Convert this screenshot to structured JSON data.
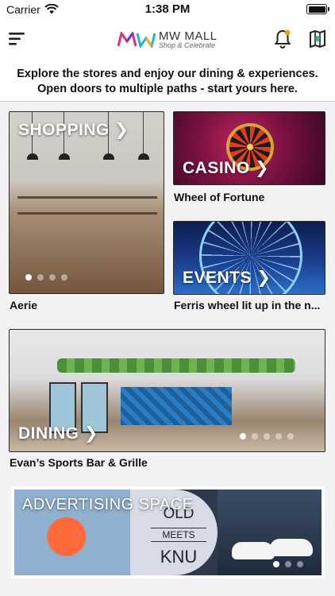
{
  "status_bar": {
    "carrier": "Carrier",
    "time": "1:38 PM"
  },
  "header": {
    "logo_title": "MW MALL",
    "logo_subtitle": "Shop & Celebrate"
  },
  "intro": {
    "line1": "Explore the stores and enjoy our dining & experiences.",
    "line2": "Open doors to multiple paths - start yours here."
  },
  "tiles": {
    "shopping": {
      "label": "SHOPPING ❯",
      "caption": "Aerie",
      "dots": 4,
      "active_dot": 0
    },
    "casino": {
      "label": "CASINO ❯",
      "caption": "Wheel of Fortune"
    },
    "events": {
      "label": "EVENTS ❯",
      "caption": "Ferris wheel lit up in the n..."
    },
    "dining": {
      "label": "DINING ❯",
      "caption": "Evan’s Sports Bar & Grille",
      "dots": 5,
      "active_dot": 0
    }
  },
  "ad": {
    "label": "ADVERTISING SPACE",
    "word1": "OLD",
    "word2": "MEETS",
    "word3": "KNU",
    "dots": 3,
    "active_dot": 0
  },
  "colors": {
    "logo_magenta": "#e0307a",
    "logo_teal": "#1fb5c9",
    "logo_purple": "#6b3cc9",
    "logo_orange": "#f5a623",
    "notification_dot": "#f39c12",
    "map_pin": "#2bb3a3"
  },
  "icons": [
    "wifi-icon",
    "battery-icon",
    "hamburger-menu-icon",
    "bell-icon",
    "map-icon"
  ]
}
